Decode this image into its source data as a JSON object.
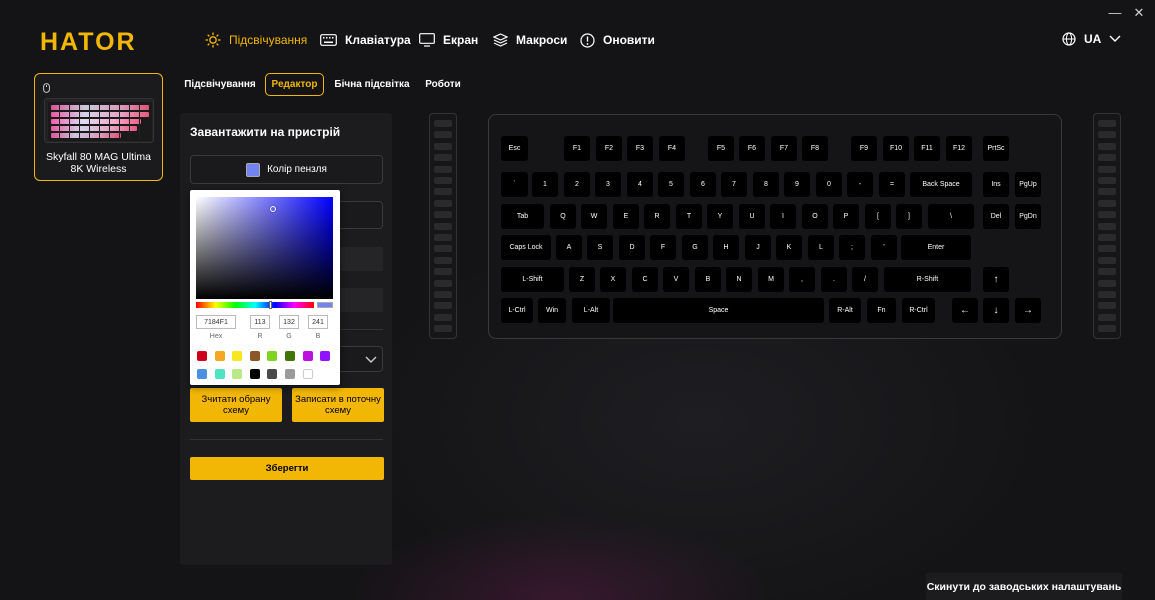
{
  "brand": {
    "logo": "HATOR"
  },
  "window": {
    "minimize": "—",
    "close": "✕"
  },
  "nav": [
    {
      "label": "Підсвічування",
      "icon": "sun-icon",
      "active": true
    },
    {
      "label": "Клавіатура",
      "icon": "keyboard-icon",
      "active": false
    },
    {
      "label": "Екран",
      "icon": "monitor-icon",
      "active": false
    },
    {
      "label": "Макроси",
      "icon": "layers-icon",
      "active": false
    },
    {
      "label": "Оновити",
      "icon": "update-icon",
      "active": false
    }
  ],
  "language": {
    "label": "UA",
    "icon": "globe-icon"
  },
  "device": {
    "name_line1": "Skyfall 80 MAG Ultima",
    "name_line2": "8K Wireless"
  },
  "subtabs": [
    {
      "label": "Підсвічування",
      "active": false
    },
    {
      "label": "Редактор",
      "active": true
    },
    {
      "label": "Бічна підсвітка",
      "active": false
    },
    {
      "label": "Роботи",
      "active": false
    }
  ],
  "panel": {
    "title": "Завантажити на пристрій",
    "brush_label": "Колір пензля",
    "brush_color": "#7184F1",
    "read_scheme": "Зчитати обрану схему",
    "write_scheme": "Записати в поточну схему",
    "save": "Зберегти"
  },
  "picker": {
    "hex": "7184F1",
    "r": "113",
    "g": "132",
    "b": "241",
    "labels": {
      "hex": "Hex",
      "r": "R",
      "g": "G",
      "b": "B"
    },
    "presets": [
      "#d0021b",
      "#f5a623",
      "#f8e71c",
      "#8b572a",
      "#7ed321",
      "#417505",
      "#bd10e0",
      "#9013fe",
      "#4a90e2",
      "#50e3c2",
      "#b8e986",
      "#000000",
      "#4a4a4a",
      "#9b9b9b",
      "#ffffff"
    ]
  },
  "keyboard": {
    "rows": [
      [
        "Esc",
        "F1",
        "F2",
        "F3",
        "F4",
        "F5",
        "F6",
        "F7",
        "F8",
        "F9",
        "F10",
        "F11",
        "F12",
        "PrtSc"
      ],
      [
        "`",
        "1",
        "2",
        "3",
        "4",
        "5",
        "6",
        "7",
        "8",
        "9",
        "0",
        "-",
        "=",
        "Back Space",
        "Ins",
        "PgUp"
      ],
      [
        "Tab",
        "Q",
        "W",
        "E",
        "R",
        "T",
        "Y",
        "U",
        "I",
        "O",
        "P",
        "[",
        "]",
        "\\",
        "Del",
        "PgDn"
      ],
      [
        "Caps Lock",
        "A",
        "S",
        "D",
        "F",
        "G",
        "H",
        "J",
        "K",
        "L",
        ";",
        "'",
        "Enter"
      ],
      [
        "L-Shift",
        "Z",
        "X",
        "C",
        "V",
        "B",
        "N",
        "M",
        ",",
        ".",
        "/",
        "R-Shift",
        "↑"
      ],
      [
        "L-Ctrl",
        "Win",
        "L-Alt",
        "Space",
        "R-Alt",
        "Fn",
        "R-Ctrl",
        "←",
        "↓",
        "→"
      ]
    ]
  },
  "footer": {
    "reset": "Скинути до заводських налаштувань"
  },
  "colors": {
    "accent": "#f2b705",
    "background": "#141416",
    "panel": "#1c1c1e"
  }
}
